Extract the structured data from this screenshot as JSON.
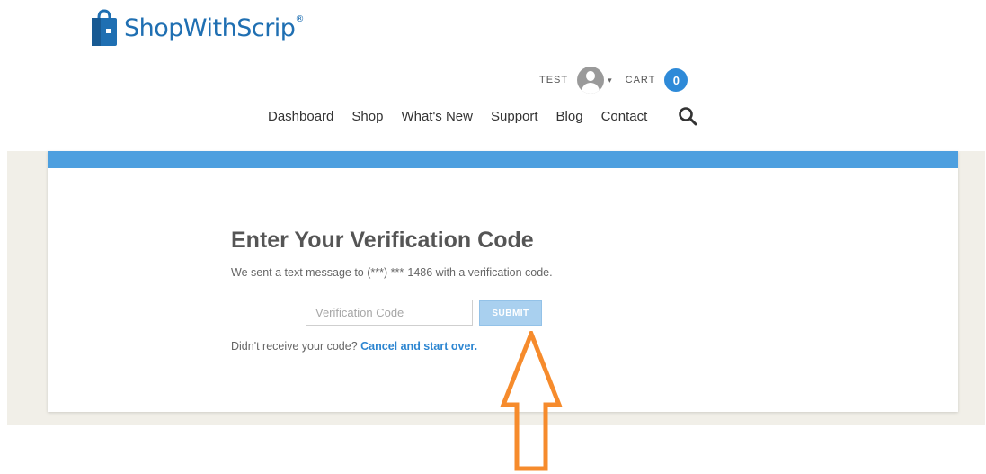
{
  "brand": {
    "name": "ShopWithScrip",
    "registered": "®"
  },
  "account": {
    "user_label": "TEST",
    "caret": "▾",
    "cart_label": "CART",
    "cart_count": "0"
  },
  "nav": {
    "items": [
      "Dashboard",
      "Shop",
      "What's New",
      "Support",
      "Blog",
      "Contact"
    ]
  },
  "verification": {
    "title": "Enter Your Verification Code",
    "message": "We sent a text message to (***) ***-1486 with a verification code.",
    "input_placeholder": "Verification Code",
    "submit_label": "SUBMIT",
    "resend_prompt": "Didn't receive your code?",
    "resend_link": "Cancel and start over."
  },
  "colors": {
    "brand_blue": "#1f6fb2",
    "accent_bar": "#4d9fdf",
    "submit_bg": "#a9d0ef",
    "link": "#2d86d1",
    "annotation_arrow": "#f68b2c"
  }
}
